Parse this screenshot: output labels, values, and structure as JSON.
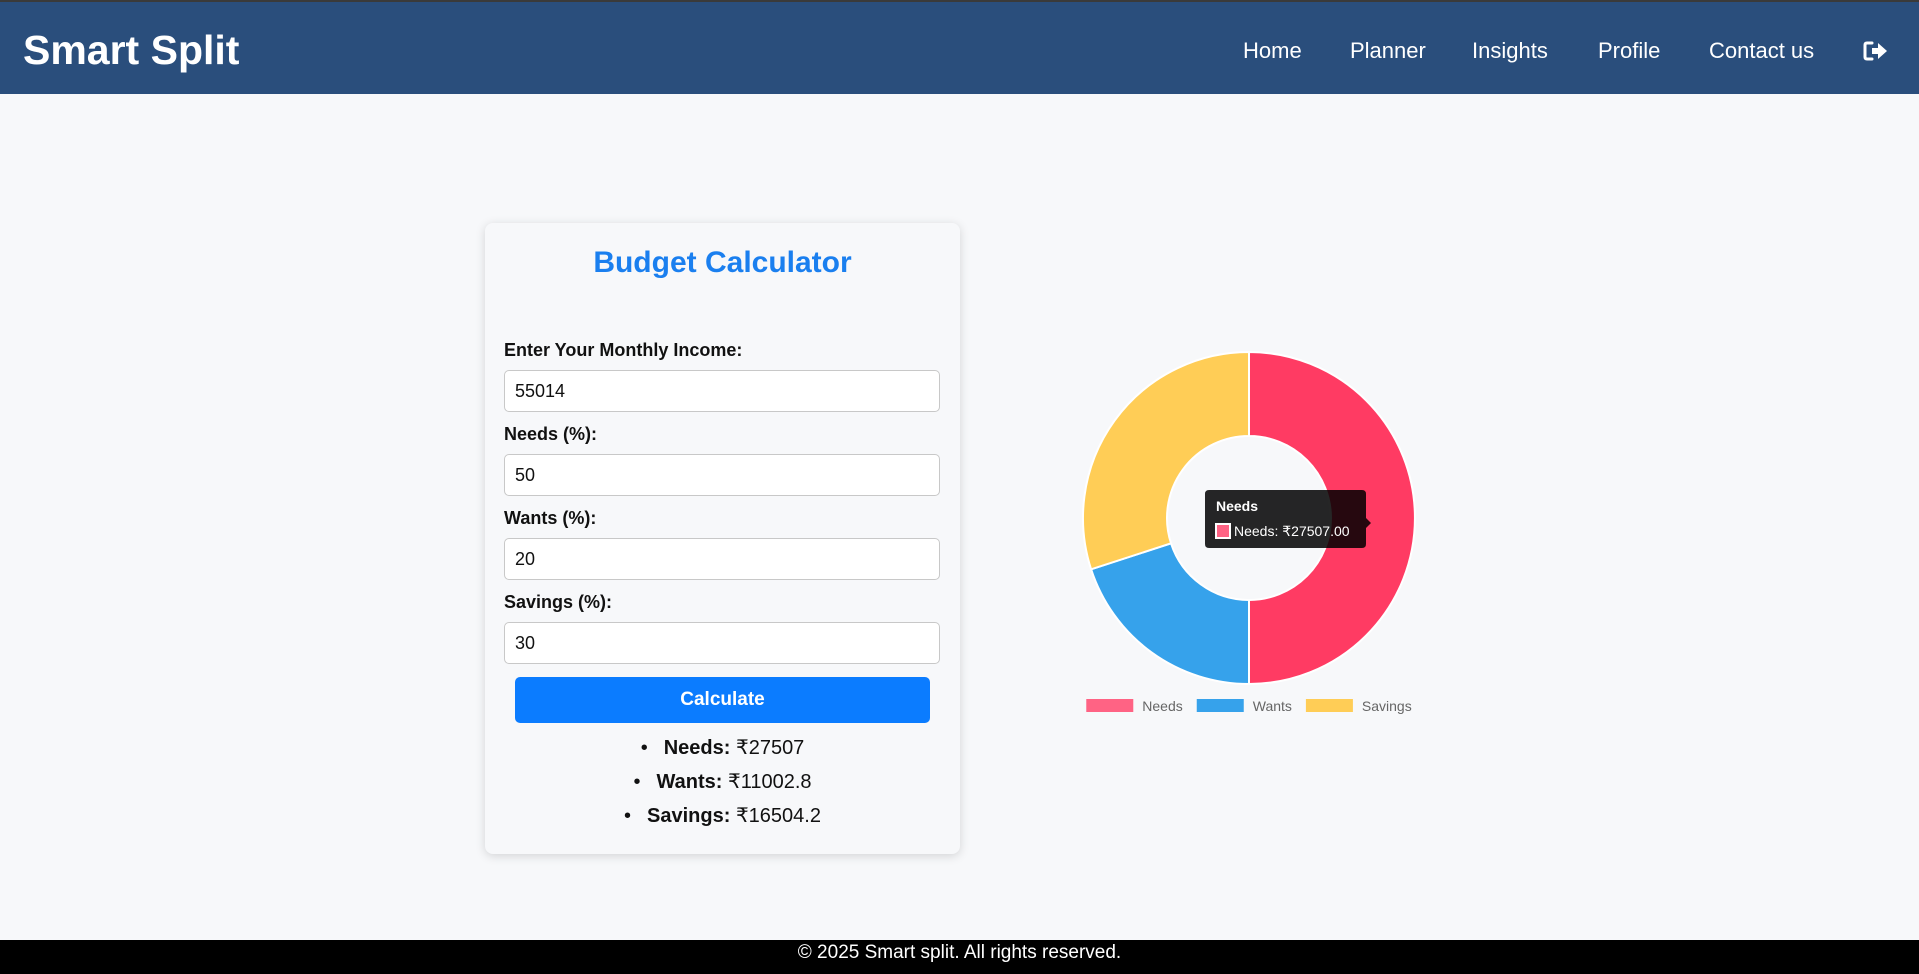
{
  "header": {
    "brand": "Smart Split",
    "nav": [
      {
        "label": "Home",
        "name": "nav-home"
      },
      {
        "label": "Planner",
        "name": "nav-planner"
      },
      {
        "label": "Insights",
        "name": "nav-insights"
      },
      {
        "label": "Profile",
        "name": "nav-profile"
      },
      {
        "label": "Contact us",
        "name": "nav-contact-us"
      }
    ],
    "logout_icon": "sign-out-icon"
  },
  "calculator": {
    "title": "Budget Calculator",
    "income_label": "Enter Your Monthly Income:",
    "income_value": "55014",
    "needs_label": "Needs (%):",
    "needs_value": "50",
    "wants_label": "Wants (%):",
    "wants_value": "20",
    "savings_label": "Savings (%):",
    "savings_value": "30",
    "button_label": "Calculate",
    "results": [
      {
        "label": "Needs:",
        "value": "₹27507"
      },
      {
        "label": "Wants:",
        "value": "₹11002.8"
      },
      {
        "label": "Savings:",
        "value": "₹16504.2"
      }
    ]
  },
  "chart_data": {
    "type": "pie",
    "categories": [
      "Needs",
      "Wants",
      "Savings"
    ],
    "values": [
      27507,
      11002.8,
      16504.2
    ],
    "colors": [
      "#ff3b63",
      "#36a2eb",
      "#ffcd56"
    ],
    "legend_colors": [
      "#ff6384",
      "#36a2eb",
      "#ffcd56"
    ],
    "legend": "bottom",
    "tooltip": {
      "title": "Needs",
      "text": "Needs: ₹27507.00"
    }
  },
  "footer": {
    "text": "© 2025 Smart split. All rights reserved."
  }
}
